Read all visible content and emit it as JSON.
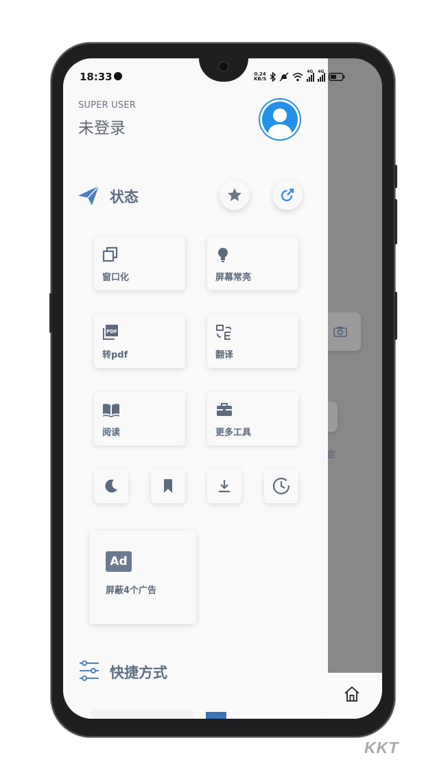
{
  "status_bar": {
    "time": "18:33",
    "net_speed_value": "0.24",
    "net_speed_unit": "KB/S",
    "network_label_1": "4G",
    "network_label_2": "4G"
  },
  "header": {
    "subtitle": "SUPER USER",
    "title": "未登录"
  },
  "status_section": {
    "title": "状态",
    "tiles": [
      {
        "label": "窗口化",
        "icon": "window-icon"
      },
      {
        "label": "屏幕常亮",
        "icon": "lightbulb-icon"
      },
      {
        "label": "转pdf",
        "icon": "pdf-icon"
      },
      {
        "label": "翻译",
        "icon": "translate-icon"
      },
      {
        "label": "阅读",
        "icon": "book-icon"
      },
      {
        "label": "更多工具",
        "icon": "briefcase-icon"
      }
    ],
    "small_tiles": [
      "moon-icon",
      "bookmark-icon",
      "download-icon",
      "history-icon"
    ]
  },
  "ad_block": {
    "badge": "Ad",
    "label": "屏蔽4个广告"
  },
  "shortcuts_section": {
    "title": "快捷方式"
  },
  "background_app": {
    "visible_text": "盒"
  },
  "watermark": "KKT",
  "colors": {
    "accent_blue": "#2391e8",
    "icon_slate": "#5d6b7e",
    "drawer_bg": "#f9f9f9",
    "scrim": "#888888"
  }
}
